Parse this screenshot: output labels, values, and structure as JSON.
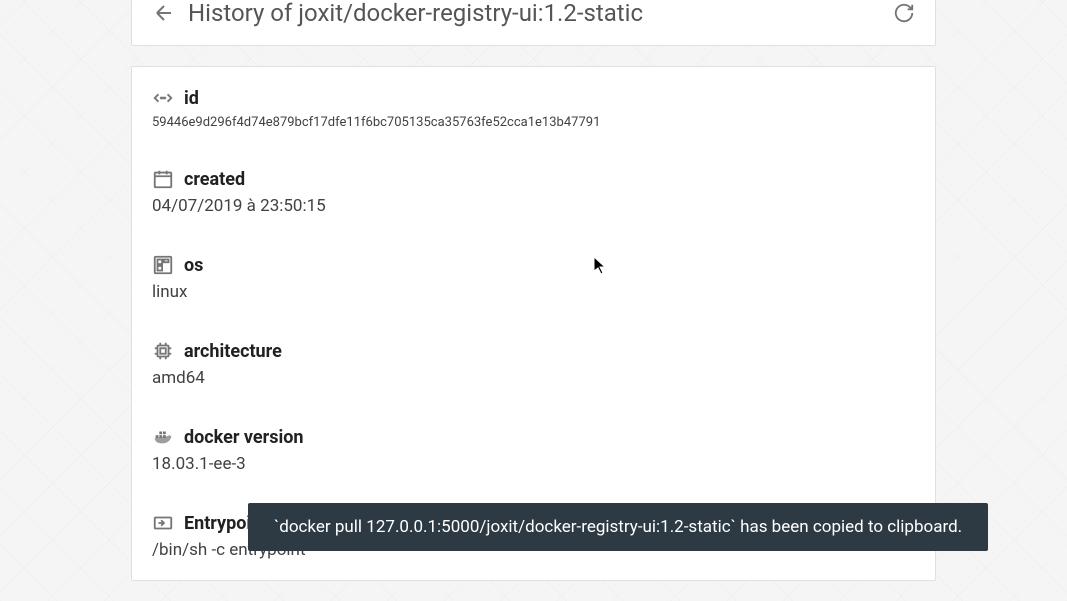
{
  "header": {
    "title": "History of joxit/docker-registry-ui:1.2-static"
  },
  "fields": {
    "id": {
      "label": "id",
      "value": "59446e9d296f4d74e879bcf17dfe11f6bc705135ca35763fe52cca1e13b47791"
    },
    "created": {
      "label": "created",
      "value": "04/07/2019 à 23:50:15"
    },
    "os": {
      "label": "os",
      "value": "linux"
    },
    "architecture": {
      "label": "architecture",
      "value": "amd64"
    },
    "docker_version": {
      "label": "docker version",
      "value": "18.03.1-ee-3"
    },
    "entrypoint": {
      "label": "Entrypoint",
      "value": "/bin/sh -c entrypoint"
    }
  },
  "toast": {
    "message": "`docker pull 127.0.0.1:5000/joxit/docker-registry-ui:1.2-static` has been copied to clipboard."
  }
}
